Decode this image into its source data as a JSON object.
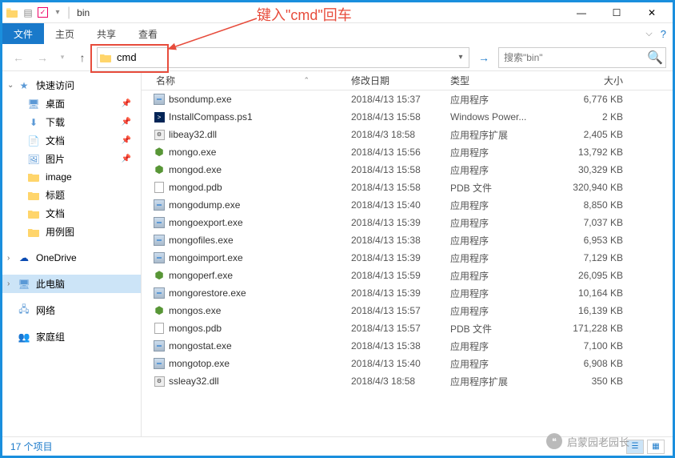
{
  "window": {
    "title": "bin"
  },
  "annotation": {
    "text": "键入\"cmd\"回车"
  },
  "ribbon": {
    "file": "文件",
    "tabs": [
      "主页",
      "共享",
      "查看"
    ]
  },
  "address": {
    "input_value": "cmd",
    "search_placeholder": "搜索\"bin\""
  },
  "columns": {
    "name": "名称",
    "date": "修改日期",
    "type": "类型",
    "size": "大小"
  },
  "nav": {
    "quick": {
      "label": "快速访问",
      "items": [
        {
          "label": "桌面",
          "icon": "desktop",
          "pin": true
        },
        {
          "label": "下载",
          "icon": "down",
          "pin": true
        },
        {
          "label": "文档",
          "icon": "doc",
          "pin": true
        },
        {
          "label": "图片",
          "icon": "pic",
          "pin": true
        },
        {
          "label": "image",
          "icon": "folder",
          "pin": false
        },
        {
          "label": "标题",
          "icon": "folder",
          "pin": false
        },
        {
          "label": "文档",
          "icon": "folder",
          "pin": false
        },
        {
          "label": "用例图",
          "icon": "folder",
          "pin": false
        }
      ]
    },
    "onedrive": "OneDrive",
    "pc": "此电脑",
    "network": "网络",
    "homegroup": "家庭组"
  },
  "files": [
    {
      "name": "bsondump.exe",
      "date": "2018/4/13 15:37",
      "type": "应用程序",
      "size": "6,776 KB",
      "icon": "exe"
    },
    {
      "name": "InstallCompass.ps1",
      "date": "2018/4/13 15:58",
      "type": "Windows Power...",
      "size": "2 KB",
      "icon": "ps1"
    },
    {
      "name": "libeay32.dll",
      "date": "2018/4/3 18:58",
      "type": "应用程序扩展",
      "size": "2,405 KB",
      "icon": "dll"
    },
    {
      "name": "mongo.exe",
      "date": "2018/4/13 15:56",
      "type": "应用程序",
      "size": "13,792 KB",
      "icon": "mongo"
    },
    {
      "name": "mongod.exe",
      "date": "2018/4/13 15:58",
      "type": "应用程序",
      "size": "30,329 KB",
      "icon": "mongo"
    },
    {
      "name": "mongod.pdb",
      "date": "2018/4/13 15:58",
      "type": "PDB 文件",
      "size": "320,940 KB",
      "icon": "file"
    },
    {
      "name": "mongodump.exe",
      "date": "2018/4/13 15:40",
      "type": "应用程序",
      "size": "8,850 KB",
      "icon": "exe"
    },
    {
      "name": "mongoexport.exe",
      "date": "2018/4/13 15:39",
      "type": "应用程序",
      "size": "7,037 KB",
      "icon": "exe"
    },
    {
      "name": "mongofiles.exe",
      "date": "2018/4/13 15:38",
      "type": "应用程序",
      "size": "6,953 KB",
      "icon": "exe"
    },
    {
      "name": "mongoimport.exe",
      "date": "2018/4/13 15:39",
      "type": "应用程序",
      "size": "7,129 KB",
      "icon": "exe"
    },
    {
      "name": "mongoperf.exe",
      "date": "2018/4/13 15:59",
      "type": "应用程序",
      "size": "26,095 KB",
      "icon": "mongo"
    },
    {
      "name": "mongorestore.exe",
      "date": "2018/4/13 15:39",
      "type": "应用程序",
      "size": "10,164 KB",
      "icon": "exe"
    },
    {
      "name": "mongos.exe",
      "date": "2018/4/13 15:57",
      "type": "应用程序",
      "size": "16,139 KB",
      "icon": "mongo"
    },
    {
      "name": "mongos.pdb",
      "date": "2018/4/13 15:57",
      "type": "PDB 文件",
      "size": "171,228 KB",
      "icon": "file"
    },
    {
      "name": "mongostat.exe",
      "date": "2018/4/13 15:38",
      "type": "应用程序",
      "size": "7,100 KB",
      "icon": "exe"
    },
    {
      "name": "mongotop.exe",
      "date": "2018/4/13 15:40",
      "type": "应用程序",
      "size": "6,908 KB",
      "icon": "exe"
    },
    {
      "name": "ssleay32.dll",
      "date": "2018/4/3 18:58",
      "type": "应用程序扩展",
      "size": "350 KB",
      "icon": "dll"
    }
  ],
  "status": {
    "count": "17 个项目"
  },
  "watermark": "启蒙园老园长"
}
